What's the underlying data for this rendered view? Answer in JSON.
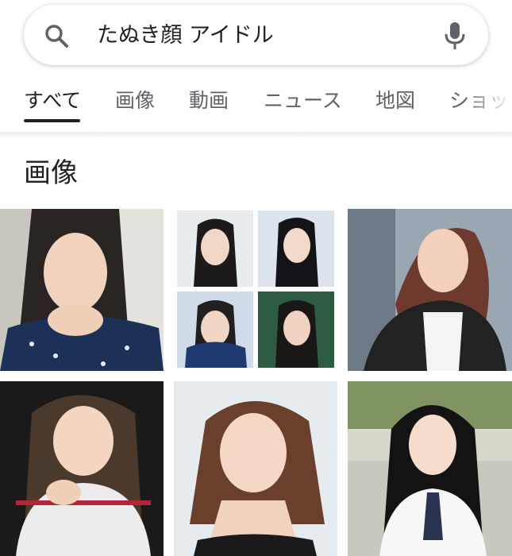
{
  "search": {
    "query": "たぬき顔 アイドル"
  },
  "tabs": [
    {
      "label": "すべて",
      "active": true
    },
    {
      "label": "画像",
      "active": false
    },
    {
      "label": "動画",
      "active": false
    },
    {
      "label": "ニュース",
      "active": false
    },
    {
      "label": "地図",
      "active": false
    },
    {
      "label": "ショッ",
      "active": false
    }
  ],
  "section": {
    "title": "画像"
  },
  "colors": {
    "accent": "#202124",
    "muted": "#5f6368",
    "icon": "#5f6368"
  },
  "icons": {
    "search": "search-icon",
    "mic": "microphone-icon"
  }
}
